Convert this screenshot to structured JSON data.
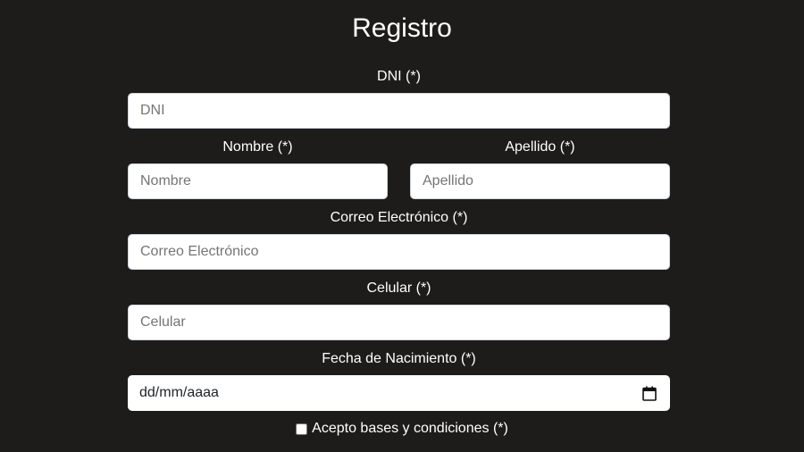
{
  "form": {
    "title": "Registro",
    "dni": {
      "label": "DNI (*)",
      "placeholder": "DNI",
      "value": ""
    },
    "nombre": {
      "label": "Nombre (*)",
      "placeholder": "Nombre",
      "value": ""
    },
    "apellido": {
      "label": "Apellido (*)",
      "placeholder": "Apellido",
      "value": ""
    },
    "correo": {
      "label": "Correo Electrónico (*)",
      "placeholder": "Correo Electrónico",
      "value": ""
    },
    "celular": {
      "label": "Celular (*)",
      "placeholder": "Celular",
      "value": ""
    },
    "fecha": {
      "label": "Fecha de Nacimiento (*)",
      "placeholder": "dd/mm/aaaa",
      "icon": "calendar-icon"
    },
    "terms": {
      "label": "Acepto bases y condiciones (*)",
      "checked": false
    }
  },
  "colors": {
    "background": "#1e1c1b",
    "text": "#ffffff",
    "input_background": "#ffffff",
    "placeholder": "#757575"
  }
}
